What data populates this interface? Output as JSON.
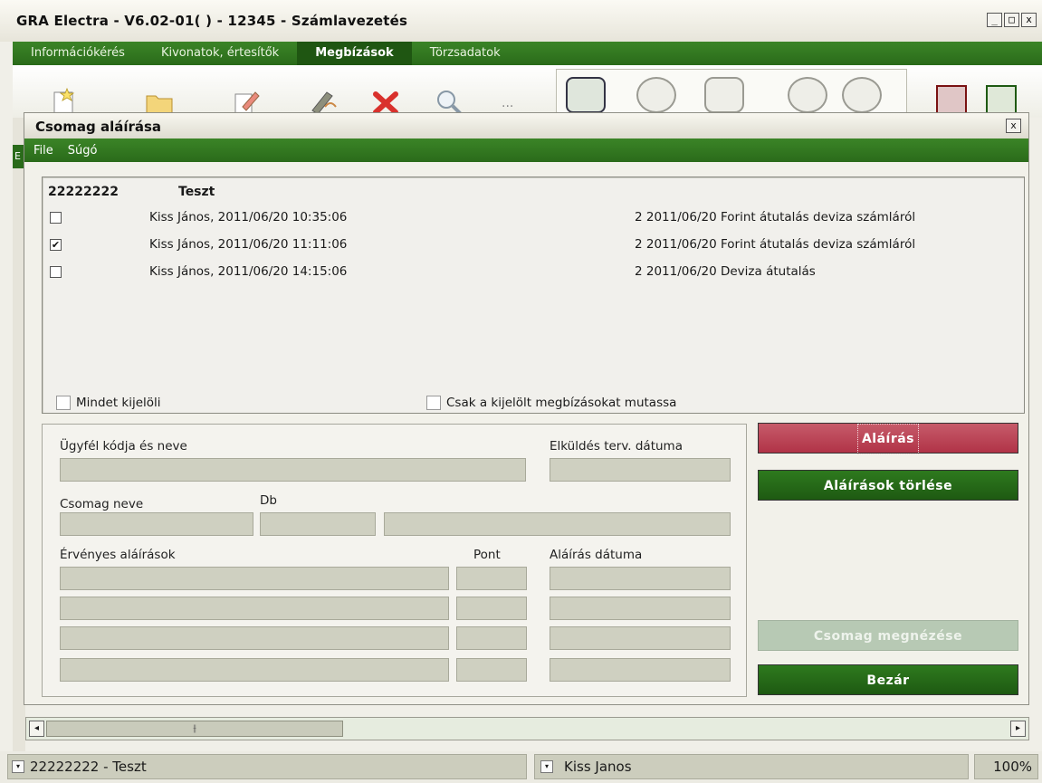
{
  "window": {
    "title": "GRA Electra - V6.02-01( ) - 12345 - Számlavezetés",
    "controls": {
      "minimize": "_",
      "maximize": "□",
      "close": "x"
    }
  },
  "main_menu": {
    "items": [
      {
        "label": "Információkérés"
      },
      {
        "label": "Kivonatok, értesítők"
      },
      {
        "label": "Megbízások",
        "active": true
      },
      {
        "label": "Törzsadatok"
      }
    ]
  },
  "toolbar": {
    "icons": [
      "new-doc-icon",
      "open-folder-icon",
      "edit-icon",
      "sign-pen-icon",
      "delete-icon",
      "search-icon",
      "more-icon",
      "package-sign-icon",
      "send-icon",
      "refresh-icon",
      "receive-icon",
      "settings-icon",
      "red-tool-icon",
      "green-tool-icon"
    ],
    "more_label": "..."
  },
  "background_window": {
    "strip_letter": "E"
  },
  "dialog": {
    "title": "Csomag aláírása",
    "close": "x",
    "menu": [
      {
        "label": "File"
      },
      {
        "label": "Súgó"
      }
    ],
    "list": {
      "group_id": "22222222",
      "group_name": "Teszt",
      "rows": [
        {
          "checked": false,
          "who": "Kiss János, 2011/06/20 10:35:06",
          "info": "2 2011/06/20  Forint átutalás deviza számláról"
        },
        {
          "checked": true,
          "who": "Kiss János, 2011/06/20 11:11:06",
          "info": "2 2011/06/20  Forint átutalás deviza számláról"
        },
        {
          "checked": false,
          "who": "Kiss János, 2011/06/20 14:15:06",
          "info": "2 2011/06/20  Deviza átutalás"
        }
      ]
    },
    "select_all_label": "Mindet kijelöli",
    "show_selected_label": "Csak a kijelölt megbízásokat mutassa",
    "form": {
      "client_label": "Ügyfél kódja és neve",
      "send_date_label": "Elküldés terv. dátuma",
      "package_name_label": "Csomag neve",
      "count_label": "Db",
      "valid_signatures_label": "Érvényes aláírások",
      "points_label": "Pont",
      "signature_date_label": "Aláírás dátuma"
    },
    "buttons": {
      "sign": "Aláírás",
      "delete_signatures": "Aláírások törlése",
      "view_package": "Csomag megnézése",
      "close": "Bezár"
    }
  },
  "statusbar": {
    "account": "22222222 - Teszt",
    "user": "Kiss Janos",
    "zoom": "100%"
  }
}
